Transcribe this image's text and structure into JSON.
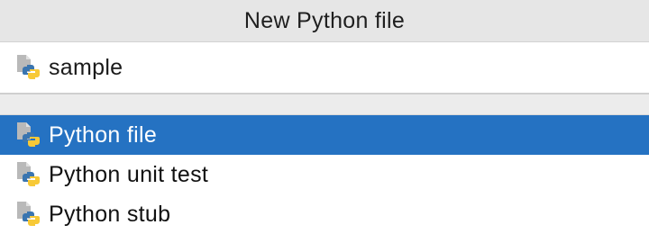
{
  "window": {
    "title": "New Python file"
  },
  "name_field": {
    "value": "sample",
    "icon": "python-file-icon"
  },
  "templates": {
    "selected_index": 0,
    "items": [
      {
        "label": "Python file",
        "icon": "python-file-icon"
      },
      {
        "label": "Python unit test",
        "icon": "python-file-icon"
      },
      {
        "label": "Python stub",
        "icon": "python-file-icon"
      }
    ]
  },
  "colors": {
    "selection": "#2572c2",
    "python_blue": "#3a75b0",
    "python_yellow": "#f7c937"
  }
}
